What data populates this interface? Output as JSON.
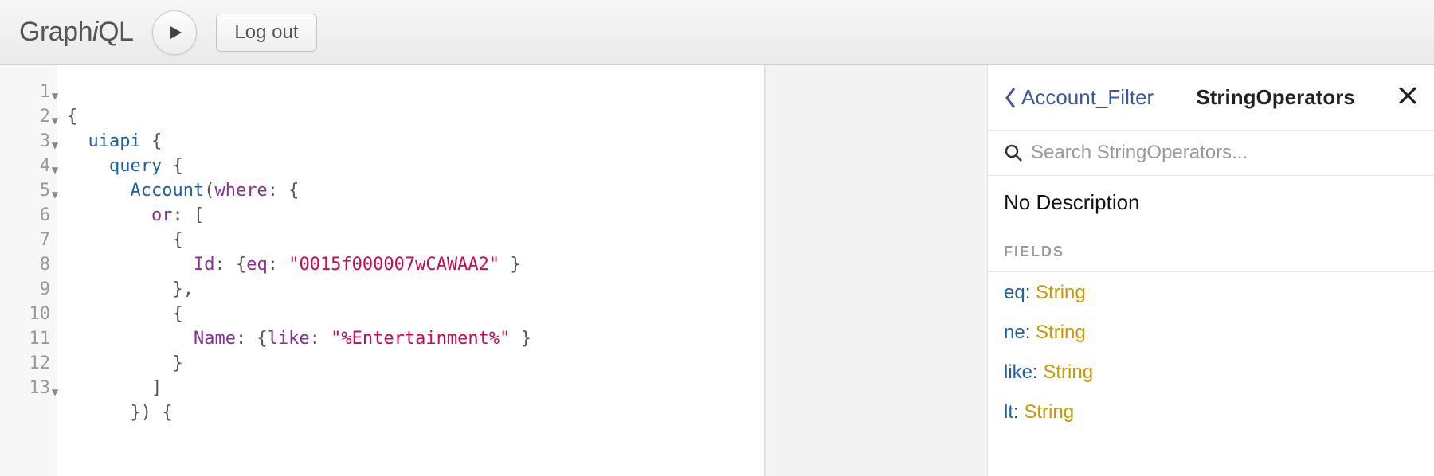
{
  "topbar": {
    "logo_pre": "Graph",
    "logo_i": "i",
    "logo_post": "QL",
    "logout_label": "Log out"
  },
  "editor": {
    "lines": [
      {
        "n": "1",
        "fold": true
      },
      {
        "n": "2",
        "fold": true
      },
      {
        "n": "3",
        "fold": true
      },
      {
        "n": "4",
        "fold": true
      },
      {
        "n": "5",
        "fold": true
      },
      {
        "n": "6",
        "fold": false
      },
      {
        "n": "7",
        "fold": false
      },
      {
        "n": "8",
        "fold": false
      },
      {
        "n": "9",
        "fold": false
      },
      {
        "n": "10",
        "fold": false
      },
      {
        "n": "11",
        "fold": false
      },
      {
        "n": "12",
        "fold": false
      },
      {
        "n": "13",
        "fold": true
      }
    ],
    "code": {
      "l1_open": "{",
      "l2_field": "uiapi",
      "l2_open": " {",
      "l3_field": "query",
      "l3_open": " {",
      "l4_field": "Account",
      "l4_paren": "(",
      "l4_arg": "where",
      "l4_rest": ": {",
      "l5_attr": "or",
      "l5_rest": ": [",
      "l6": "{",
      "l7_attr": "Id",
      "l7_mid": ": {",
      "l7_key": "eq",
      "l7_col": ": ",
      "l7_str": "\"0015f000007wCAWAA2\"",
      "l7_end": " }",
      "l8": "},",
      "l9": "{",
      "l10_attr": "Name",
      "l10_mid": ": {",
      "l10_key": "like",
      "l10_col": ": ",
      "l10_str": "\"%Entertainment%\"",
      "l10_end": " }",
      "l11": "}",
      "l12": "]",
      "l13": "}) {"
    }
  },
  "docs": {
    "back_label": "Account_Filter",
    "title": "StringOperators",
    "search_placeholder": "Search StringOperators...",
    "description": "No Description",
    "section_title": "FIELDS",
    "fields": [
      {
        "name": "eq",
        "type": "String"
      },
      {
        "name": "ne",
        "type": "String"
      },
      {
        "name": "like",
        "type": "String"
      },
      {
        "name": "lt",
        "type": "String"
      }
    ]
  }
}
